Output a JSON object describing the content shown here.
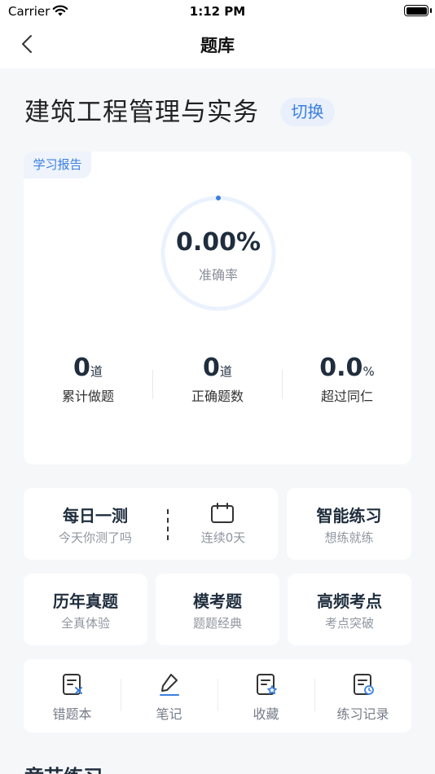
{
  "status_bar": {
    "carrier": "Carrier",
    "time": "1:12 PM"
  },
  "nav": {
    "title": "题库"
  },
  "subject": {
    "title": "建筑工程管理与实务",
    "switch_label": "切换"
  },
  "report": {
    "tag": "学习报告",
    "accuracy_value": "0.00%",
    "accuracy_label": "准确率",
    "accuracy_fraction": 0,
    "stats": [
      {
        "value": "0",
        "unit": "道",
        "label": "累计做题"
      },
      {
        "value": "0",
        "unit": "道",
        "label": "正确题数"
      },
      {
        "value": "0.0",
        "unit": "%",
        "label": "超过同仁"
      }
    ]
  },
  "daily": {
    "title": "每日一测",
    "subtitle": "今天你测了吗",
    "streak": "连续0天"
  },
  "smart": {
    "title": "智能练习",
    "subtitle": "想练就练"
  },
  "cards": [
    {
      "title": "历年真题",
      "subtitle": "全真体验"
    },
    {
      "title": "模考题",
      "subtitle": "题题经典"
    },
    {
      "title": "高频考点",
      "subtitle": "考点突破"
    }
  ],
  "tools": [
    {
      "label": "错题本",
      "icon": "wrong-questions-icon"
    },
    {
      "label": "笔记",
      "icon": "pencil-icon"
    },
    {
      "label": "收藏",
      "icon": "favorites-icon"
    },
    {
      "label": "练习记录",
      "icon": "practice-record-icon"
    }
  ],
  "section": {
    "title": "章节练习"
  },
  "colors": {
    "accent": "#3a7fe0",
    "ring_track": "#ebf2fd"
  }
}
